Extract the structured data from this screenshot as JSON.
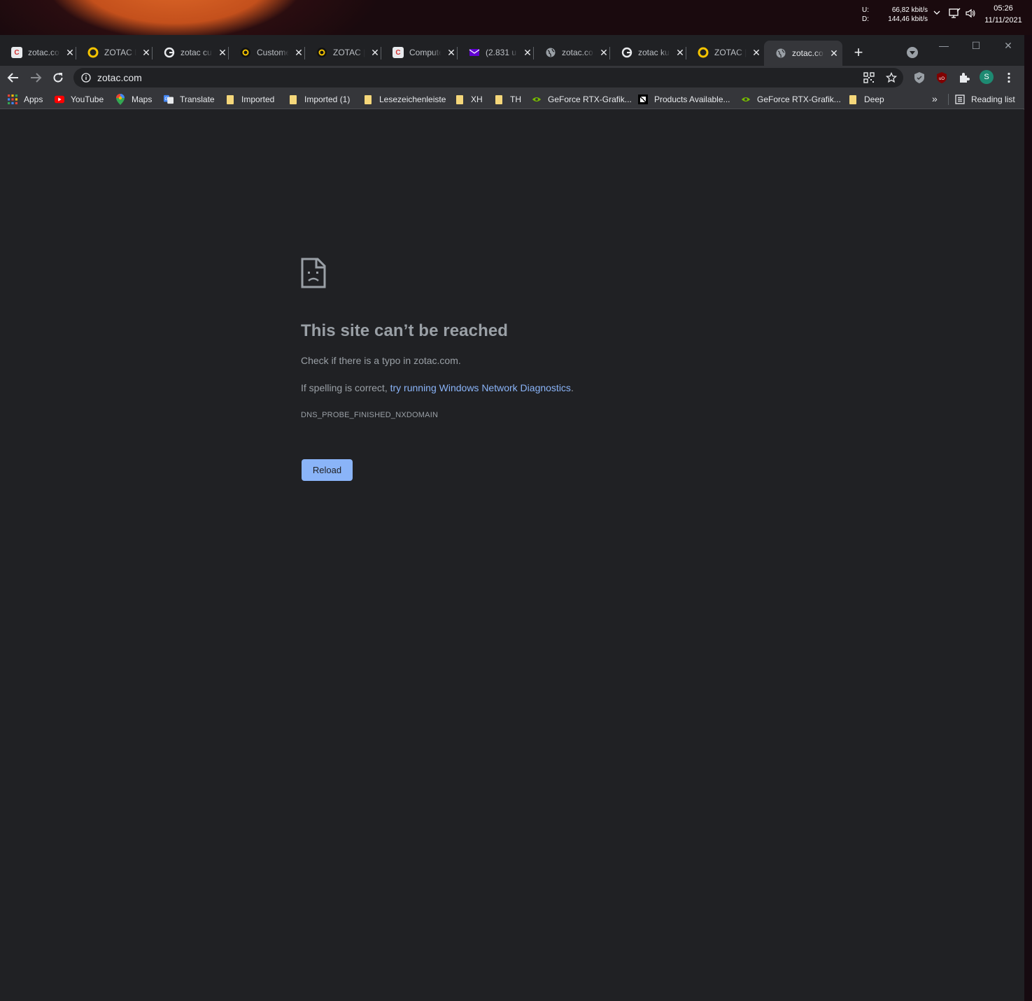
{
  "taskbar": {
    "upload_label": "U:",
    "download_label": "D:",
    "upload_speed": "66,82 kbit/s",
    "download_speed": "144,46 kbit/s",
    "time": "05:26",
    "date": "11/11/2021"
  },
  "tabs": [
    {
      "title": "zotac.com",
      "icon": "cb-icon"
    },
    {
      "title": "ZOTAC D",
      "icon": "zotac-icon"
    },
    {
      "title": "zotac cu",
      "icon": "google-icon"
    },
    {
      "title": "Custome",
      "icon": "zotac-icon"
    },
    {
      "title": "ZOTAC |",
      "icon": "zotac-icon"
    },
    {
      "title": "Computer",
      "icon": "cb-icon"
    },
    {
      "title": "(2.831 u",
      "icon": "mail-icon"
    },
    {
      "title": "zotac.co",
      "icon": "globe-icon"
    },
    {
      "title": "zotac ku",
      "icon": "google-icon"
    },
    {
      "title": "ZOTAC |",
      "icon": "zotac-icon"
    },
    {
      "title": "zotac.co",
      "icon": "globe-icon",
      "active": true
    }
  ],
  "omnibox": {
    "url": "zotac.com"
  },
  "profile": {
    "initial": "S"
  },
  "bookmarks": [
    {
      "label": "Apps",
      "icon": "apps-grid-icon"
    },
    {
      "label": "YouTube",
      "icon": "youtube-icon"
    },
    {
      "label": "Maps",
      "icon": "maps-icon"
    },
    {
      "label": "Translate",
      "icon": "translate-icon"
    },
    {
      "label": "Imported",
      "icon": "folder-icon"
    },
    {
      "label": "Imported (1)",
      "icon": "folder-icon"
    },
    {
      "label": "Lesezeichenleiste",
      "icon": "folder-icon"
    },
    {
      "label": "XH",
      "icon": "folder-icon"
    },
    {
      "label": "TH",
      "icon": "folder-icon"
    },
    {
      "label": "GeForce RTX-Grafik...",
      "icon": "nvidia-icon"
    },
    {
      "label": "Products Available...",
      "icon": "amd-icon"
    },
    {
      "label": "GeForce RTX-Grafik...",
      "icon": "nvidia-icon"
    },
    {
      "label": "Deep",
      "icon": "folder-icon"
    }
  ],
  "bookmarks_overflow": "»",
  "reading_list": "Reading list",
  "error_page": {
    "title": "This site can’t be reached",
    "line1": "Check if there is a typo in zotac.com.",
    "line2_prefix": "If spelling is correct, ",
    "line2_link": "try running Windows Network Diagnostics",
    "line2_suffix": ".",
    "error_code": "DNS_PROBE_FINISHED_NXDOMAIN",
    "reload_label": "Reload"
  },
  "colors": {
    "page_background": "#202124",
    "toolbar": "#35363a",
    "link": "#8ab4f8",
    "button": "#8ab4f8",
    "text_muted": "#9aa0a6"
  }
}
